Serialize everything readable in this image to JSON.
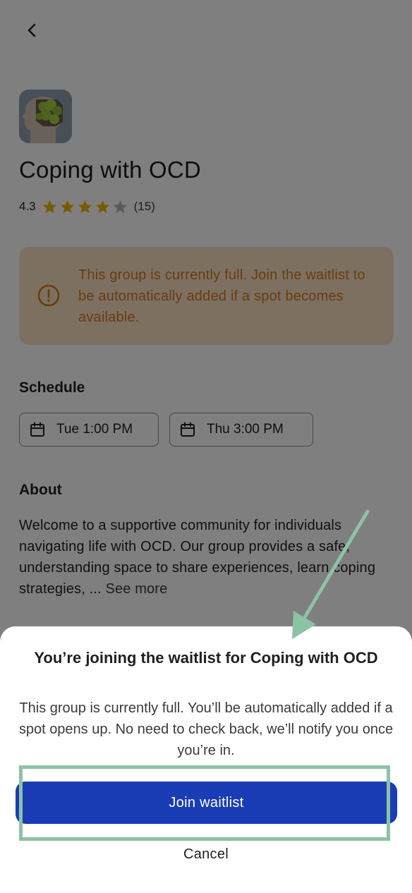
{
  "header": {
    "back_icon": "chevron-left-icon"
  },
  "group": {
    "logo_icon": "ocd-head-logo",
    "title": "Coping with OCD",
    "rating": {
      "score": "4.3",
      "stars": 4,
      "max_stars": 5,
      "count": "(15)"
    }
  },
  "alert": {
    "icon": "exclamation-circle-icon",
    "text": "This group is currently full. Join the waitlist to be automatically added if a spot becomes available."
  },
  "schedule": {
    "heading": "Schedule",
    "slots": [
      {
        "label": "Tue 1:00 PM",
        "icon": "calendar-icon"
      },
      {
        "label": "Thu 3:00 PM",
        "icon": "calendar-icon"
      }
    ]
  },
  "about": {
    "heading": "About",
    "text": "Welcome to a supportive community for individuals navigating life with OCD. Our group provides a safe, understanding space to share experiences, learn coping strategies, ...",
    "see_more": "See more"
  },
  "sheet": {
    "title": "You’re joining the waitlist for Coping with OCD",
    "body": "This group is currently full. You’ll be automatically added if a spot opens up. No need to check back, we’ll notify you once you’re in.",
    "primary_label": "Join waitlist",
    "cancel_label": "Cancel"
  },
  "colors": {
    "primary": "#1a3db5",
    "alert_bg": "#fbe0c3",
    "alert_text": "#d07a20",
    "star": "#f3b400",
    "annotation": "#8cc3a4"
  }
}
